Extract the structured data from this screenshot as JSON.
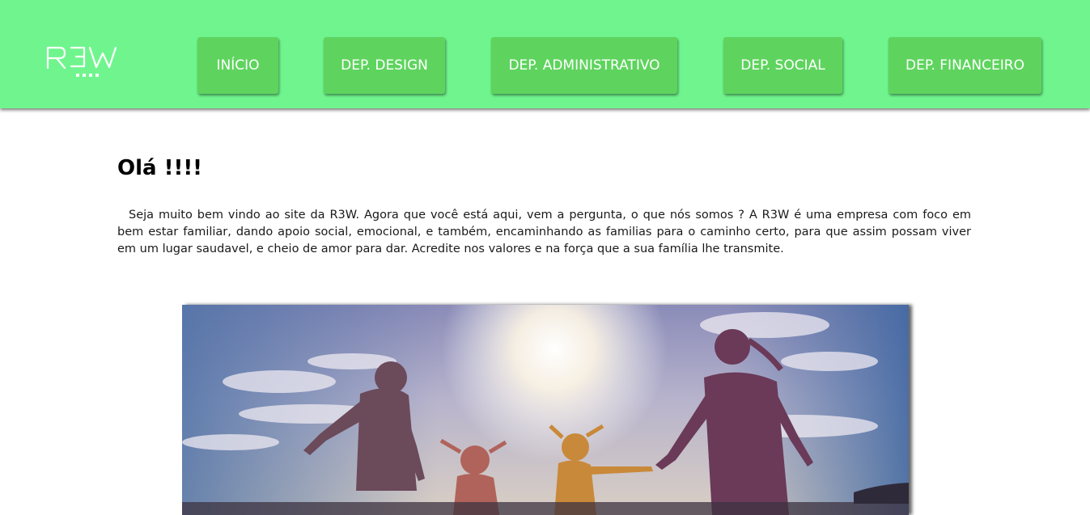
{
  "logo": {
    "text": "R3W"
  },
  "nav": [
    {
      "label": "INÍCIO"
    },
    {
      "label": "DEP. DESIGN"
    },
    {
      "label": "DEP. ADMINISTRATIVO"
    },
    {
      "label": "DEP. SOCIAL"
    },
    {
      "label": "DEP. FINANCEIRO"
    }
  ],
  "content": {
    "title": "Olá !!!!",
    "intro": "Seja muito bem vindo ao site da R3W. Agora que você está aqui, vem a pergunta, o que nós somos ? A R3W é uma empresa com foco em bem estar familiar, dando apoio social, emocional, e também, encaminhando as familias para o caminho certo, para que assim possam viver em um lugar saudavel, e cheio de amor para dar. Acredite nos valores e na força que a sua família lhe transmite."
  },
  "colors": {
    "header_bg": "#70f58e",
    "button_bg": "#5ed45e",
    "button_text": "#ffffff"
  }
}
